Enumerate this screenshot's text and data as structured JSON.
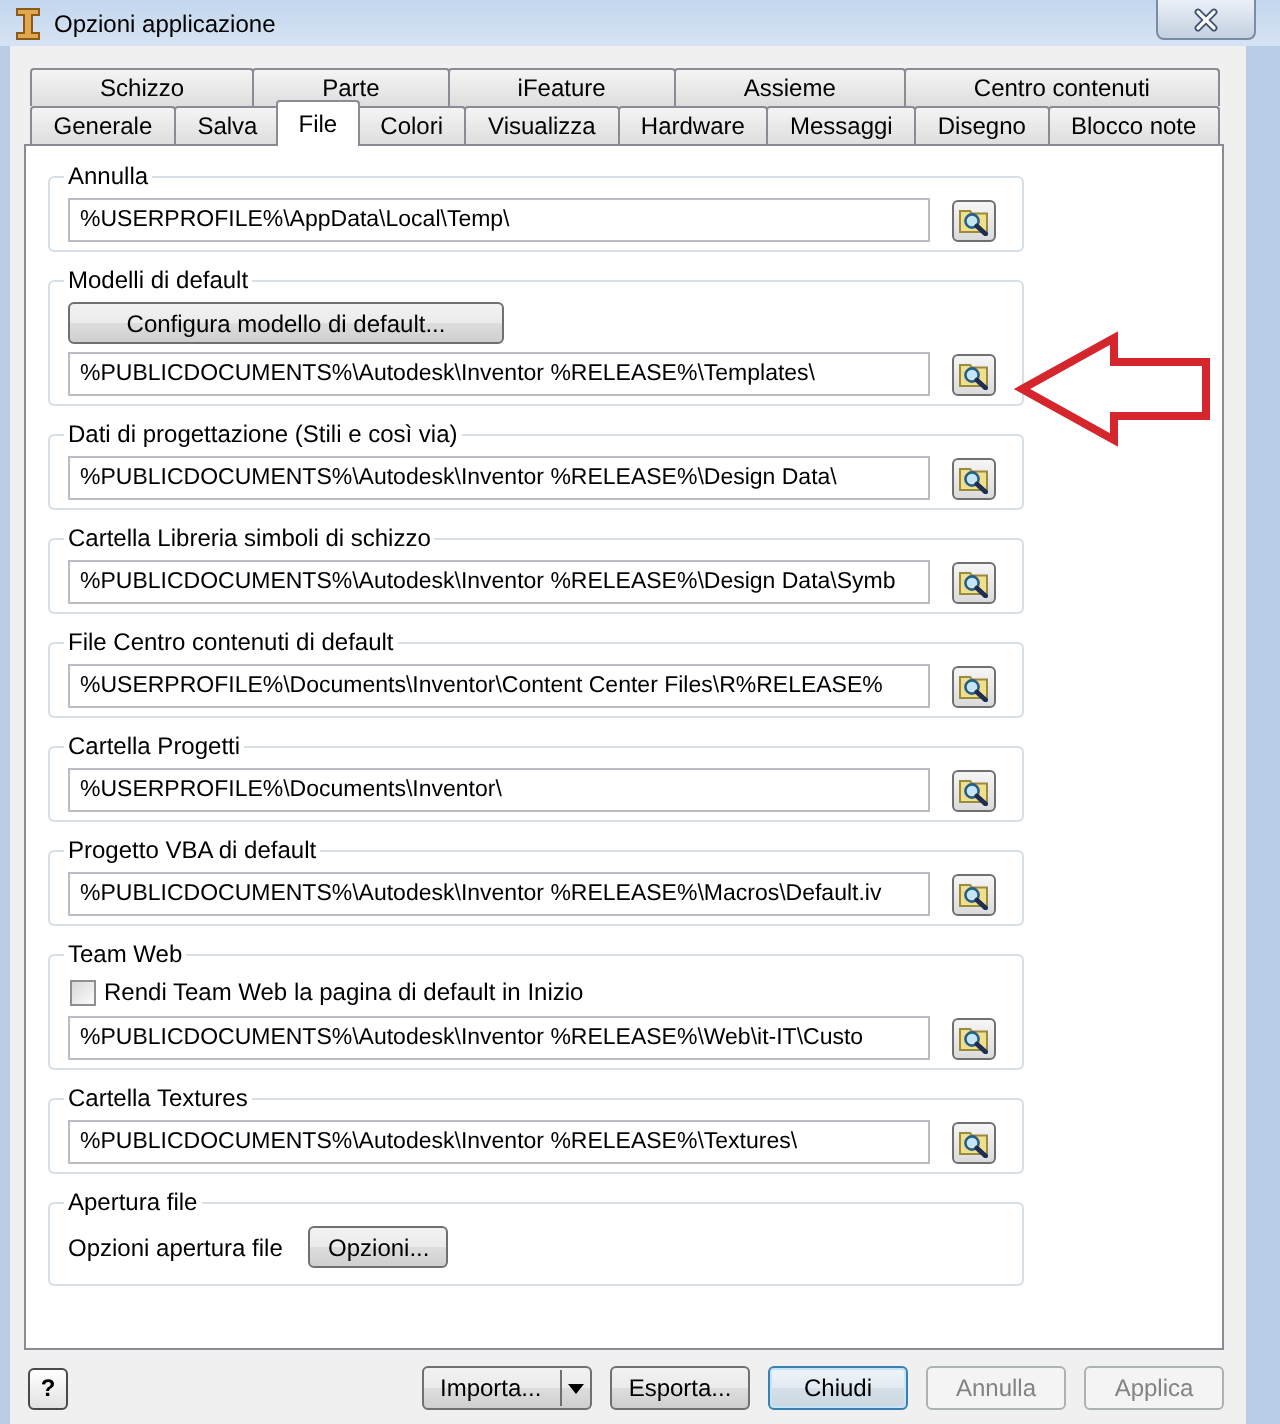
{
  "window": {
    "title": "Opzioni applicazione"
  },
  "tab_rows": [
    {
      "tabs": [
        {
          "label": "Schizzo",
          "selected": false
        },
        {
          "label": "Parte",
          "selected": false
        },
        {
          "label": "iFeature",
          "selected": false
        },
        {
          "label": "Assieme",
          "selected": false
        },
        {
          "label": "Centro contenuti",
          "selected": false
        }
      ]
    },
    {
      "tabs": [
        {
          "label": "Generale",
          "selected": false
        },
        {
          "label": "Salva",
          "selected": false
        },
        {
          "label": "File",
          "selected": true
        },
        {
          "label": "Colori",
          "selected": false
        },
        {
          "label": "Visualizza",
          "selected": false
        },
        {
          "label": "Hardware",
          "selected": false
        },
        {
          "label": "Messaggi",
          "selected": false
        },
        {
          "label": "Disegno",
          "selected": false
        },
        {
          "label": "Blocco note",
          "selected": false
        }
      ]
    }
  ],
  "groups": [
    {
      "title": "Annulla",
      "kind": "path",
      "path": "%USERPROFILE%\\AppData\\Local\\Temp\\",
      "callout": false
    },
    {
      "title": "Modelli di default",
      "kind": "button_path",
      "button": "Configura modello di default...",
      "path": "%PUBLICDOCUMENTS%\\Autodesk\\Inventor %RELEASE%\\Templates\\",
      "callout": true
    },
    {
      "title": "Dati di progettazione (Stili e così via)",
      "kind": "path",
      "path": "%PUBLICDOCUMENTS%\\Autodesk\\Inventor %RELEASE%\\Design Data\\",
      "callout": false
    },
    {
      "title": "Cartella Libreria simboli di schizzo",
      "kind": "path",
      "path": "%PUBLICDOCUMENTS%\\Autodesk\\Inventor %RELEASE%\\Design Data\\Symb",
      "callout": false
    },
    {
      "title": "File Centro contenuti di default",
      "kind": "path",
      "path": "%USERPROFILE%\\Documents\\Inventor\\Content Center Files\\R%RELEASE%",
      "callout": false
    },
    {
      "title": "Cartella Progetti",
      "kind": "path",
      "path": "%USERPROFILE%\\Documents\\Inventor\\",
      "callout": false
    },
    {
      "title": "Progetto VBA di default",
      "kind": "path",
      "path": "%PUBLICDOCUMENTS%\\Autodesk\\Inventor %RELEASE%\\Macros\\Default.iv",
      "callout": false
    },
    {
      "title": "Team Web",
      "kind": "checkbox_path",
      "checkbox": {
        "label": "Rendi Team Web la pagina di default in Inizio",
        "checked": false
      },
      "path": "%PUBLICDOCUMENTS%\\Autodesk\\Inventor %RELEASE%\\Web\\it-IT\\Custo",
      "callout": false
    },
    {
      "title": "Cartella Textures",
      "kind": "path",
      "path": "%PUBLICDOCUMENTS%\\Autodesk\\Inventor %RELEASE%\\Textures\\",
      "callout": false
    },
    {
      "title": "Apertura file",
      "kind": "options",
      "label": "Opzioni apertura file",
      "button": "Opzioni...",
      "callout": false
    }
  ],
  "footer": {
    "help": "?",
    "buttons": [
      {
        "label": "Importa...",
        "kind": "split",
        "disabled": false,
        "default": false
      },
      {
        "label": "Esporta...",
        "kind": "push",
        "disabled": false,
        "default": false
      },
      {
        "label": "Chiudi",
        "kind": "push",
        "disabled": false,
        "default": true
      },
      {
        "label": "Annulla",
        "kind": "push",
        "disabled": true,
        "default": false
      },
      {
        "label": "Applica",
        "kind": "push",
        "disabled": true,
        "default": false
      }
    ]
  }
}
